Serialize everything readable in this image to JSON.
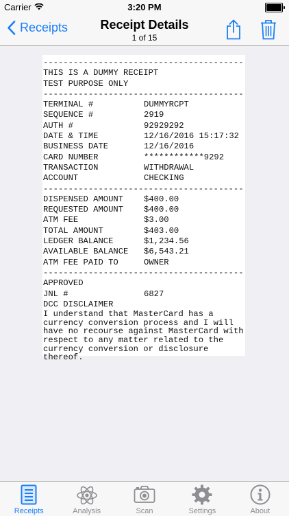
{
  "status_bar": {
    "carrier": "Carrier",
    "time": "3:20 PM"
  },
  "nav": {
    "back_label": "Receipts",
    "title": "Receipt Details",
    "subtitle": "1 of 15"
  },
  "receipt": {
    "separator": "----------------------------------------",
    "header_lines": [
      "THIS IS A DUMMY RECEIPT",
      "TEST PURPOSE ONLY"
    ],
    "section1": [
      {
        "label": "TERMINAL #",
        "value": "DUMMYRCPT"
      },
      {
        "label": "SEQUENCE #",
        "value": "2919"
      },
      {
        "label": "AUTH #",
        "value": "92929292"
      },
      {
        "label": "DATE & TIME",
        "value": "12/16/2016 15:17:32"
      },
      {
        "label": "BUSINESS DATE",
        "value": "12/16/2016"
      },
      {
        "label": "CARD NUMBER",
        "value": "************9292"
      },
      {
        "label": "TRANSACTION",
        "value": "WITHDRAWAL"
      },
      {
        "label": "ACCOUNT",
        "value": "CHECKING"
      }
    ],
    "section2": [
      {
        "label": "DISPENSED AMOUNT",
        "value": "$400.00"
      },
      {
        "label": "REQUESTED AMOUNT",
        "value": "$400.00"
      },
      {
        "label": "ATM FEE",
        "value": "$3.00"
      },
      {
        "label": "TOTAL AMOUNT",
        "value": "$403.00"
      },
      {
        "label": "LEDGER BALANCE",
        "value": "$1,234.56"
      },
      {
        "label": "AVAILABLE BALANCE",
        "value": "$6,543.21"
      },
      {
        "label": "ATM FEE PAID TO",
        "value": "OWNER"
      }
    ],
    "approved": "APPROVED",
    "jnl": {
      "label": "JNL #",
      "value": "6827"
    },
    "disclaimer_title": "DCC DISCLAIMER",
    "disclaimer_text": "I understand that MasterCard has a\ncurrency conversion process and I will\nhave no recourse against MasterCard with\nrespect to any matter related to the\ncurrency conversion or disclosure\nthereof."
  },
  "tabs": [
    {
      "label": "Receipts",
      "icon": "receipt-icon",
      "active": true
    },
    {
      "label": "Analysis",
      "icon": "atom-icon",
      "active": false
    },
    {
      "label": "Scan",
      "icon": "camera-icon",
      "active": false
    },
    {
      "label": "Settings",
      "icon": "gear-icon",
      "active": false
    },
    {
      "label": "About",
      "icon": "info-icon",
      "active": false
    }
  ],
  "colors": {
    "accent": "#1a7ef5",
    "inactive": "#8e8e93",
    "bar_background": "#f7f7f7",
    "page_background": "#efeff4"
  }
}
